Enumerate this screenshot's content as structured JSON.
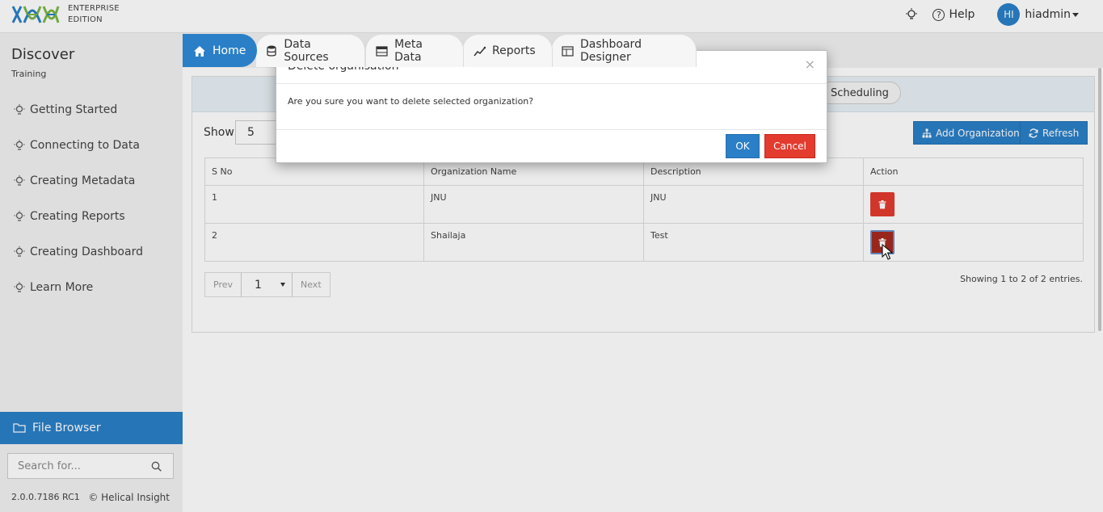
{
  "header": {
    "edition_line1": "ENTERPRISE",
    "edition_line2": "EDITION",
    "help_label": "Help",
    "avatar_initials": "HI",
    "username": "hiadmin",
    "accent_color": "#2a7fc7"
  },
  "sidebar": {
    "title": "Discover",
    "subtitle": "Training",
    "items": [
      {
        "label": "Getting Started",
        "icon": "bulb-icon"
      },
      {
        "label": "Connecting to Data",
        "icon": "bulb-icon"
      },
      {
        "label": "Creating Metadata",
        "icon": "bulb-icon"
      },
      {
        "label": "Creating Reports",
        "icon": "bulb-icon"
      },
      {
        "label": "Creating Dashboard",
        "icon": "bulb-icon"
      },
      {
        "label": "Learn More",
        "icon": "bulb-icon"
      }
    ],
    "file_browser_label": "File Browser",
    "search_placeholder": "Search for...",
    "version": "2.0.0.7186 RC1",
    "copyright": "© Helical Insight"
  },
  "tabs": [
    {
      "label": "Home",
      "icon": "home-icon",
      "active": true
    },
    {
      "label": "Data Sources",
      "icon": "database-icon",
      "active": false
    },
    {
      "label": "Meta Data",
      "icon": "table-icon",
      "active": false
    },
    {
      "label": "Reports",
      "icon": "chart-icon",
      "active": false
    },
    {
      "label": "Dashboard Designer",
      "icon": "dashboard-icon",
      "active": false
    }
  ],
  "main": {
    "scheduling_label": "Scheduling",
    "show_label": "Show",
    "show_value": "5",
    "add_org_label": "Add Organization",
    "refresh_label": "Refresh",
    "table": {
      "columns": [
        "S No",
        "Organization Name",
        "Description",
        "Action"
      ],
      "rows": [
        {
          "sno": "1",
          "name": "JNU",
          "description": "JNU"
        },
        {
          "sno": "2",
          "name": "Shailaja",
          "description": "Test"
        }
      ]
    },
    "pager": {
      "prev": "Prev",
      "page": "1",
      "next": "Next"
    },
    "entries_text": "Showing 1 to 2 of 2 entries."
  },
  "modal": {
    "title": "Delete organisation",
    "close": "×",
    "message": "Are you sure you want to delete selected organization?",
    "ok_label": "OK",
    "cancel_label": "Cancel"
  }
}
